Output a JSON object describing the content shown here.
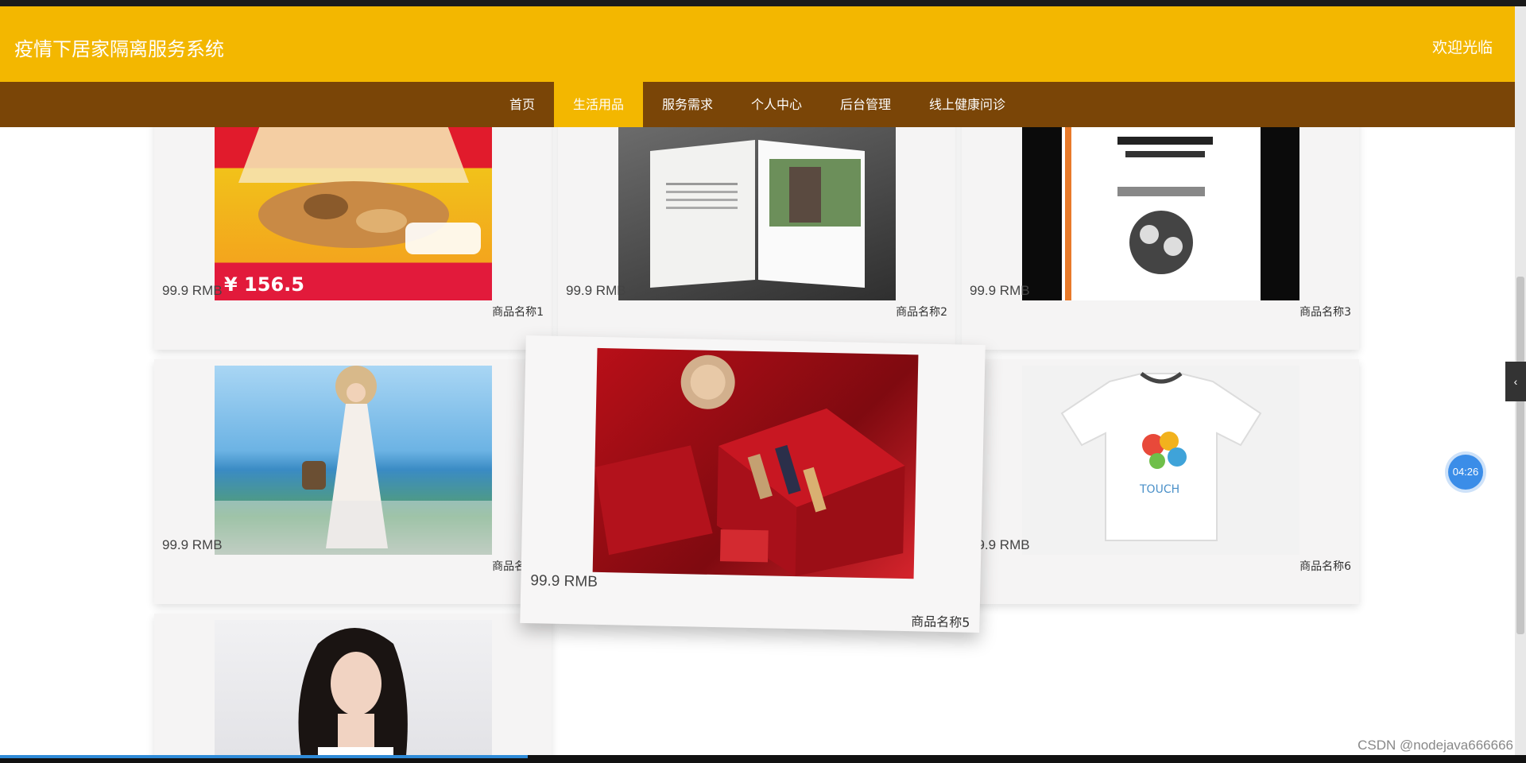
{
  "header": {
    "title": "疫情下居家隔离服务系统",
    "welcome": "欢迎光临"
  },
  "nav": {
    "items": [
      {
        "label": "首页"
      },
      {
        "label": "生活用品"
      },
      {
        "label": "服务需求"
      },
      {
        "label": "个人中心"
      },
      {
        "label": "后台管理"
      },
      {
        "label": "线上健康问诊"
      }
    ],
    "active_index": 1
  },
  "products": [
    {
      "price": "99.9 RMB",
      "name": "商品名称1"
    },
    {
      "price": "99.9 RMB",
      "name": "商品名称2"
    },
    {
      "price": "99.9 RMB",
      "name": "商品名称3"
    },
    {
      "price": "99.9 RMB",
      "name": "商品名称4"
    },
    {
      "price": "99.9 RMB",
      "name": "商品名称5"
    },
    {
      "price": "99.9 RMB",
      "name": "商品名称6"
    }
  ],
  "overlay": {
    "timer": "04:26",
    "side_handle_icon": "chevron-left-icon",
    "watermark": "CSDN @nodejava666666"
  },
  "colors": {
    "header": "#f3b700",
    "nav": "#7a4507",
    "active_nav": "#f3b700"
  }
}
